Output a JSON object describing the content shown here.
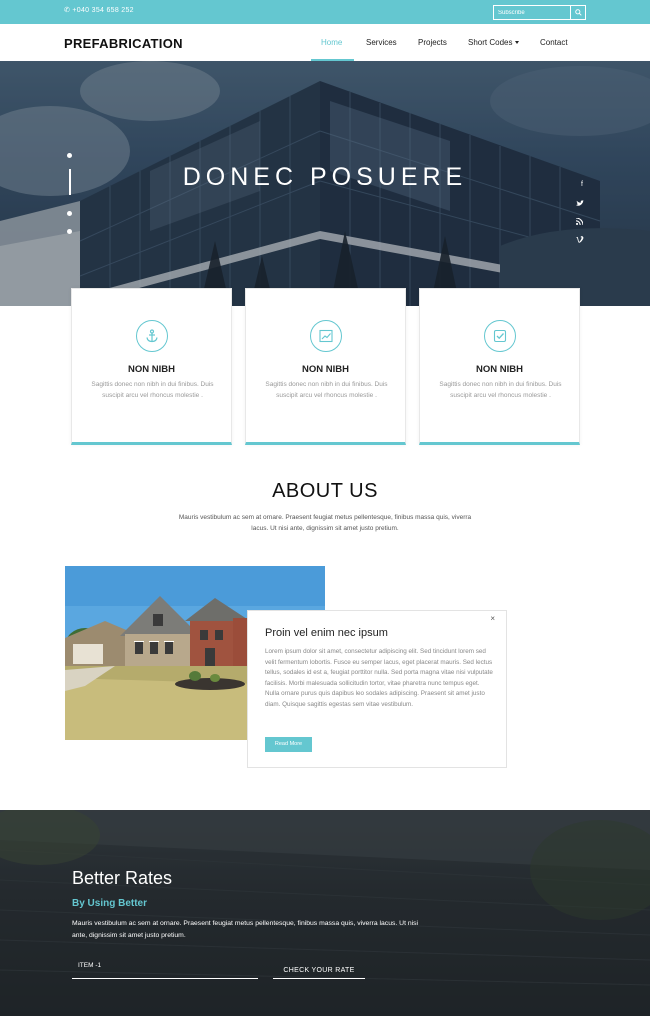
{
  "topbar": {
    "phone": "✆ +040 354 658 252",
    "subscribe_placeholder": "Subscribe"
  },
  "navbar": {
    "brand": "PREFABRICATION",
    "items": [
      {
        "label": "Home",
        "active": true
      },
      {
        "label": "Services",
        "active": false
      },
      {
        "label": "Projects",
        "active": false
      },
      {
        "label": "Short Codes",
        "active": false,
        "dropdown": true
      },
      {
        "label": "Contact",
        "active": false
      }
    ]
  },
  "hero": {
    "title": "DONEC POSUERE",
    "social_icons": [
      "facebook-icon",
      "twitter-icon",
      "rss-icon",
      "vimeo-icon"
    ]
  },
  "features": [
    {
      "icon": "anchor-icon",
      "title": "NON NIBH",
      "description": "Sagittis donec non nibh in dui finibus. Duis suscipit arcu vel rhoncus molestie ."
    },
    {
      "icon": "chart-icon",
      "title": "NON NIBH",
      "description": "Sagittis donec non nibh in dui finibus. Duis suscipit arcu vel rhoncus molestie ."
    },
    {
      "icon": "check-icon",
      "title": "NON NIBH",
      "description": "Sagittis donec non nibh in dui finibus. Duis suscipit arcu vel rhoncus molestie ."
    }
  ],
  "about": {
    "title": "ABOUT US",
    "text": "Mauris vestibulum ac sem at ornare. Praesent feugiat metus pellentesque, finibus massa quis, viverra lacus. Ut nisi ante, dignissim sit amet justo pretium.",
    "card": {
      "title": "Proin vel enim nec ipsum",
      "text": "Lorem ipsum dolor sit amet, consectetur adipiscing elit. Sed tincidunt lorem sed velit fermentum lobortis. Fusce eu semper lacus, eget placerat mauris. Sed lectus tellus, sodales id est a, feugiat porttitor nulla. Sed porta magna vitae nisi vulputate facilisis. Morbi malesuada sollicitudin tortor, vitae pharetra nunc tempus eget. Nulla ornare purus quis dapibus leo sodales adipiscing. Praesent sit amet justo diam. Quisque sagittis egestas sem vitae vestibulum.",
      "button": "Read More",
      "close": "×"
    }
  },
  "rates": {
    "title": "Better Rates",
    "subtitle": "By Using Better",
    "text": "Mauris vestibulum ac sem at ornare. Praesent feugiat metus pellentesque, finibus massa quis, viverra lacus. Ut nisi ante, dignissim sit amet justo pretium.",
    "field_label": "ITEM -1",
    "button": "CHECK YOUR RATE"
  },
  "colors": {
    "accent": "#64c7d0",
    "dark": "#2d3338"
  }
}
